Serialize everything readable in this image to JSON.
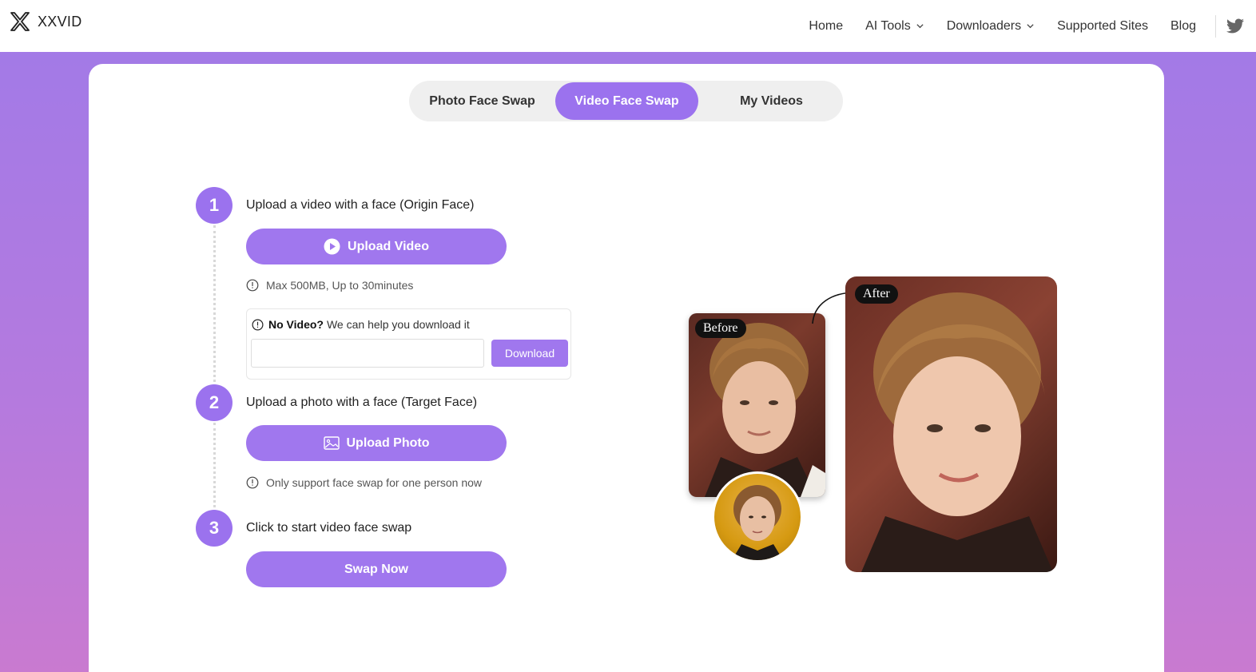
{
  "header": {
    "brand": "XXVID",
    "nav": [
      {
        "label": "Home",
        "has_dropdown": false
      },
      {
        "label": "AI Tools",
        "has_dropdown": true
      },
      {
        "label": "Downloaders",
        "has_dropdown": true
      },
      {
        "label": "Supported Sites",
        "has_dropdown": false
      },
      {
        "label": "Blog",
        "has_dropdown": false
      }
    ],
    "social_icon": "twitter-icon"
  },
  "tabs": [
    {
      "label": "Photo Face Swap",
      "active": false
    },
    {
      "label": "Video Face Swap",
      "active": true
    },
    {
      "label": "My Videos",
      "active": false
    }
  ],
  "steps": [
    {
      "number": "1",
      "title": "Upload a video with a face  (Origin Face)",
      "button": "Upload Video",
      "button_icon": "play-circle-icon",
      "hint": "Max 500MB, Up to 30minutes"
    },
    {
      "number": "2",
      "title": "Upload a photo with a face  (Target Face)",
      "button": "Upload Photo",
      "button_icon": "image-icon",
      "hint": "Only support face swap for one person now"
    },
    {
      "number": "3",
      "title": "Click to start video face swap",
      "button": "Swap Now"
    }
  ],
  "download_box": {
    "bold": "No Video?",
    "text": "We can help you download it",
    "input_value": "",
    "button": "Download"
  },
  "illustration": {
    "before_label": "Before",
    "after_label": "After"
  },
  "colors": {
    "accent": "#9b72ee",
    "button": "#a077ee",
    "background_top": "#a07ae8",
    "background_bottom": "#c97ad0"
  }
}
